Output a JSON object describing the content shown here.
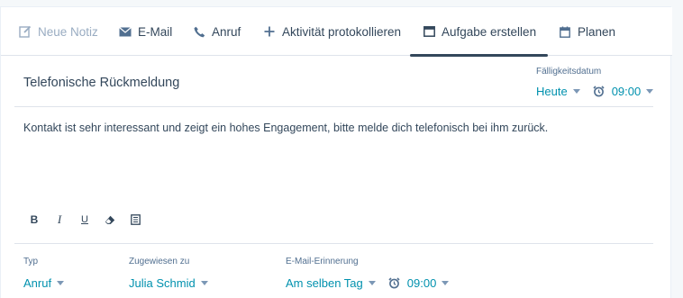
{
  "tabs": [
    {
      "label": "Neue Notiz",
      "icon": "pencil-note-icon",
      "disabled": true
    },
    {
      "label": "E-Mail",
      "icon": "envelope-icon"
    },
    {
      "label": "Anruf",
      "icon": "phone-icon"
    },
    {
      "label": "Aktivität protokollieren",
      "icon": "plus-icon"
    },
    {
      "label": "Aufgabe erstellen",
      "icon": "task-window-icon",
      "active": true
    },
    {
      "label": "Planen",
      "icon": "calendar-icon"
    }
  ],
  "task": {
    "title": "Telefonische Rückmeldung",
    "due_label": "Fälligkeitsdatum",
    "due_date": "Heute",
    "due_time": "09:00",
    "body": "Kontakt ist sehr interessant und zeigt ein hohes Engagement, bitte melde dich telefonisch bei ihm zurück."
  },
  "toolbar": {
    "bold": "B",
    "italic": "I",
    "underline": "U"
  },
  "footer": {
    "type_label": "Typ",
    "type_value": "Anruf",
    "assigned_label": "Zugewiesen zu",
    "assigned_value": "Julia Schmid",
    "reminder_label": "E-Mail-Erinnerung",
    "reminder_value": "Am selben Tag",
    "reminder_time": "09:00"
  },
  "colors": {
    "text": "#33475b",
    "link": "#0091ae",
    "muted": "#99acc2",
    "divider": "#dfe3eb"
  }
}
